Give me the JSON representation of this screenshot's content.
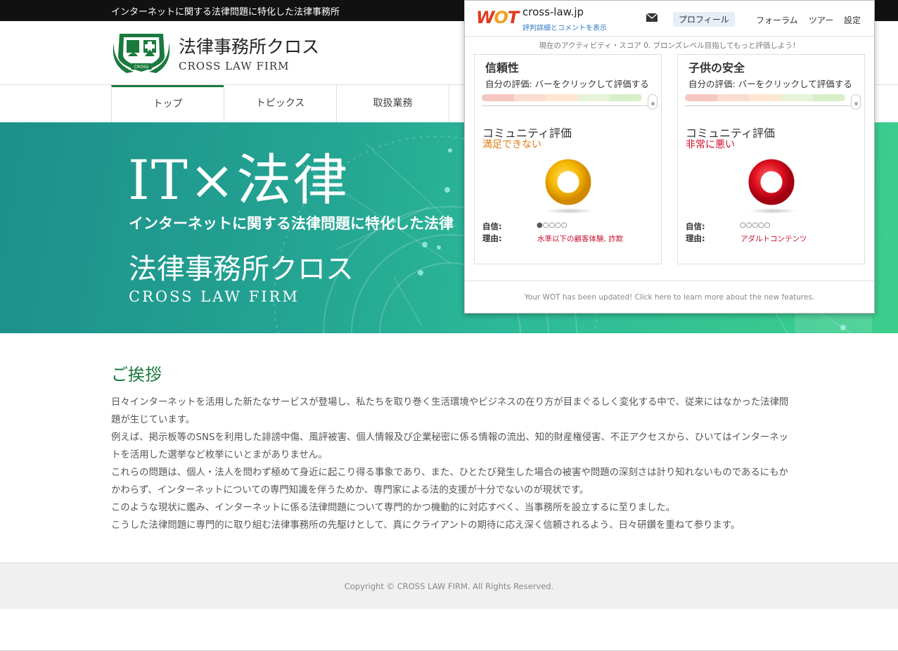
{
  "topbar": {
    "text": "インターネットに関する法律問題に特化した法律事務所"
  },
  "header": {
    "logo_emblem_text": "CROSS",
    "logo_jp": "法律事務所クロス",
    "logo_en": "CROSS LAW FIRM"
  },
  "nav": {
    "items": [
      {
        "label": "トップ"
      },
      {
        "label": "トピックス"
      },
      {
        "label": "取扱業務"
      }
    ]
  },
  "hero": {
    "title": "IT×法律",
    "subtitle": "インターネットに関する法律問題に特化した法律",
    "firm_jp": "法律事務所クロス",
    "firm_en": "CROSS LAW FIRM"
  },
  "greeting": {
    "title": "ご挨拶",
    "paragraphs": [
      "日々インターネットを活用した新たなサービスが登場し、私たちを取り巻く生活環境やビジネスの在り方が目まぐるしく変化する中で、従来にはなかった法律問題が生じています。",
      "例えば、掲示板等のSNSを利用した誹謗中傷、風評被害、個人情報及び企業秘密に係る情報の流出、知的財産権侵害、不正アクセスから、ひいてはインターネットを活用した選挙など枚挙にいとまがありません。",
      "これらの問題は、個人・法人を問わず極めて身近に起こり得る事象であり、また、ひとたび発生した場合の被害や問題の深刻さは計り知れないものであるにもかかわらず、インターネットについての専門知識を伴うためか、専門家による法的支援が十分でないのが現状です。",
      "このような現状に鑑み、インターネットに係る法律問題について専門的かつ機動的に対応すべく、当事務所を設立するに至りました。",
      "こうした法律問題に専門的に取り組む法律事務所の先駆けとして、真にクライアントの期待に応え深く信頼されるよう、日々研鑽を重ねて参ります。"
    ]
  },
  "footer": {
    "copyright": "Copyright © CROSS LAW FIRM. All Rights Reserved."
  },
  "wot": {
    "logo_w": "W",
    "logo_o": "O",
    "logo_t": "T",
    "domain": "cross-law.jp",
    "detail_link": "評判詳細とコメントを表示",
    "mail_icon": "envelope-icon",
    "profile": "プロフィール",
    "forum": "フォーラム",
    "tour": "ツアー",
    "settings": "設定",
    "activity": "現在のアクティビティ・スコア 0. ブロンズレベル目指してもっと評価しよう！",
    "panels": [
      {
        "title": "信頼性",
        "own_rating": "自分の評価: バーをクリックして評価する",
        "community_label": "コミュニティ評価",
        "community_value": "満足できない",
        "value_color": "#e07b10",
        "donut_color": "#f5b800",
        "confidence_label": "自信:",
        "confidence_dots": "●○○○○",
        "confidence_level": 1,
        "reason_label": "理由:",
        "reason": "水準以下の顧客体験, 詐欺"
      },
      {
        "title": "子供の安全",
        "own_rating": "自分の評価: バーをクリックして評価する",
        "community_label": "コミュニティ評価",
        "community_value": "非常に悪い",
        "value_color": "#d0102a",
        "donut_color": "#e01020",
        "confidence_label": "自信:",
        "confidence_dots": "○○○○○",
        "confidence_level": 0,
        "reason_label": "理由:",
        "reason": "アダルトコンテンツ"
      }
    ],
    "update_notice": "Your WOT has been updated! Click here to learn more about the new features."
  }
}
